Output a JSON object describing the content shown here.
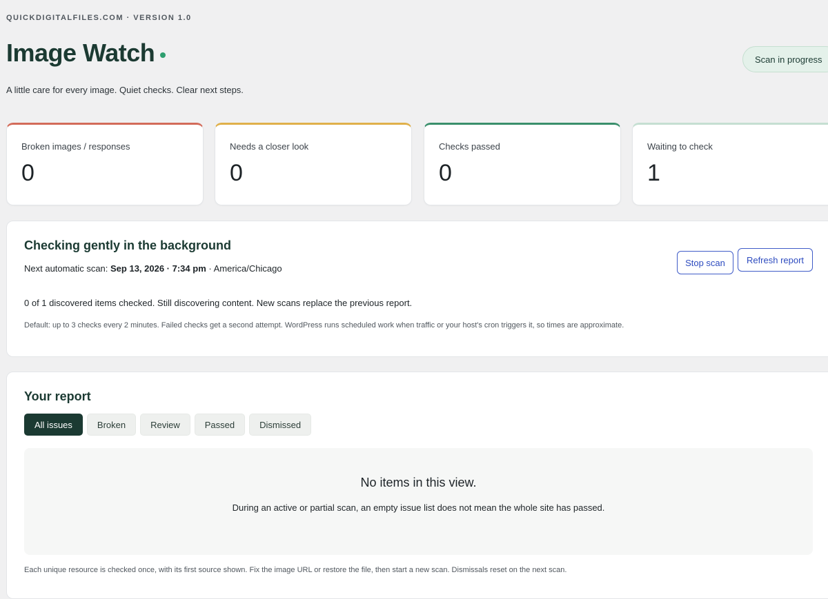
{
  "header": {
    "eyebrow": "QUICKDIGITALFILES.COM · VERSION 1.0",
    "title": "Image Watch",
    "status_pill": "Scan in progress",
    "tagline": "A little care for every image. Quiet checks. Clear next steps."
  },
  "stats": [
    {
      "label": "Broken images / responses",
      "value": "0",
      "accent": "#d36b5a"
    },
    {
      "label": "Needs a closer look",
      "value": "0",
      "accent": "#e0b04a"
    },
    {
      "label": "Checks passed",
      "value": "0",
      "accent": "#3a8f6c"
    },
    {
      "label": "Waiting to check",
      "value": "1",
      "accent": "#c5dfd2"
    }
  ],
  "scan": {
    "title": "Checking gently in the background",
    "next_scan_label": "Next automatic scan:",
    "next_scan_datetime": "Sep 13, 2026 · 7:34 pm",
    "next_scan_tz": "· America/Chicago",
    "progress": "0 of 1 discovered items checked. Still discovering content. New scans replace the previous report.",
    "fine_print": "Default: up to 3 checks every 2 minutes. Failed checks get a second attempt. WordPress runs scheduled work when traffic or your host's cron triggers it, so times are approximate.",
    "stop_label": "Stop scan",
    "refresh_label": "Refresh report"
  },
  "report": {
    "title": "Your report",
    "tabs": [
      {
        "label": "All issues",
        "active": true
      },
      {
        "label": "Broken",
        "active": false
      },
      {
        "label": "Review",
        "active": false
      },
      {
        "label": "Passed",
        "active": false
      },
      {
        "label": "Dismissed",
        "active": false
      }
    ],
    "empty_title": "No items in this view.",
    "empty_sub": "During an active or partial scan, an empty issue list does not mean the whole site has passed.",
    "note": "Each unique resource is checked once, with its first source shown. Fix the image URL or restore the file, then start a new scan. Dismissals reset on the next scan."
  },
  "colors": {
    "brand_dark": "#1b3a32",
    "live_dot": "#2e9e6f",
    "button_blue": "#2d4bbf"
  }
}
